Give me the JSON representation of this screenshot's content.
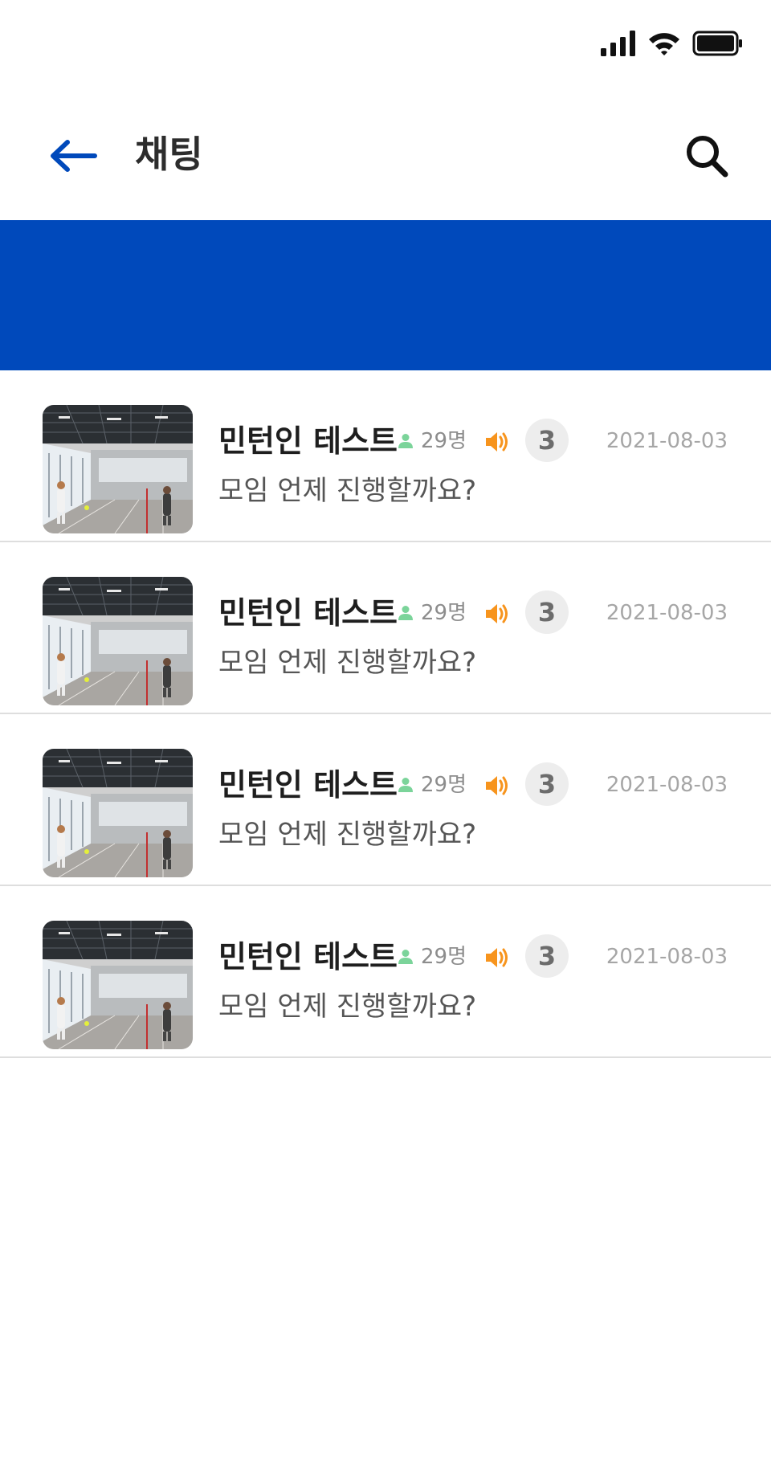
{
  "header": {
    "title": "채팅"
  },
  "colors": {
    "brand": "#0049bb",
    "member_icon": "#7bd49a",
    "speaker_icon": "#f7941d",
    "badge_bg": "#ededed"
  },
  "icons": {
    "back": "arrow-left-icon",
    "search": "search-icon",
    "member": "person-icon",
    "speaker": "speaker-icon"
  },
  "chats": [
    {
      "name": "민턴인 테스트",
      "members": "29명",
      "unread": "3",
      "date": "2021-08-03",
      "last_message": "모임 언제 진행할까요?"
    },
    {
      "name": "민턴인 테스트",
      "members": "29명",
      "unread": "3",
      "date": "2021-08-03",
      "last_message": "모임 언제 진행할까요?"
    },
    {
      "name": "민턴인 테스트",
      "members": "29명",
      "unread": "3",
      "date": "2021-08-03",
      "last_message": "모임 언제 진행할까요?"
    },
    {
      "name": "민턴인 테스트",
      "members": "29명",
      "unread": "3",
      "date": "2021-08-03",
      "last_message": "모임 언제 진행할까요?"
    }
  ]
}
